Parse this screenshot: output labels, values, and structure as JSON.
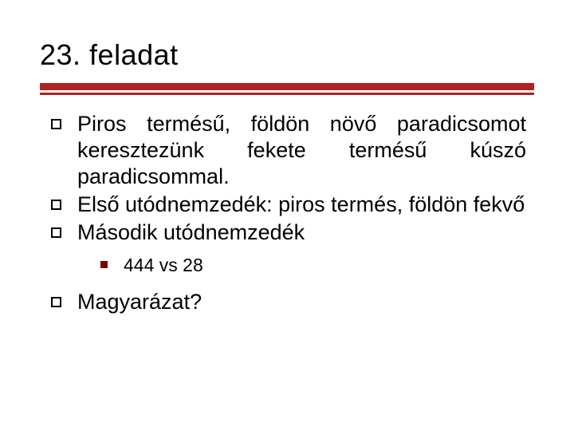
{
  "title": "23. feladat",
  "bullets": {
    "b1": "Piros termésű, földön növő paradicsomot keresztezünk fekete termésű kúszó paradicsommal.",
    "b2": "Első utódnemzedék: piros termés, földön fekvő",
    "b3": "Második utódnemzedék",
    "b3_sub": "444 vs 28",
    "b4": "Magyarázat?"
  }
}
